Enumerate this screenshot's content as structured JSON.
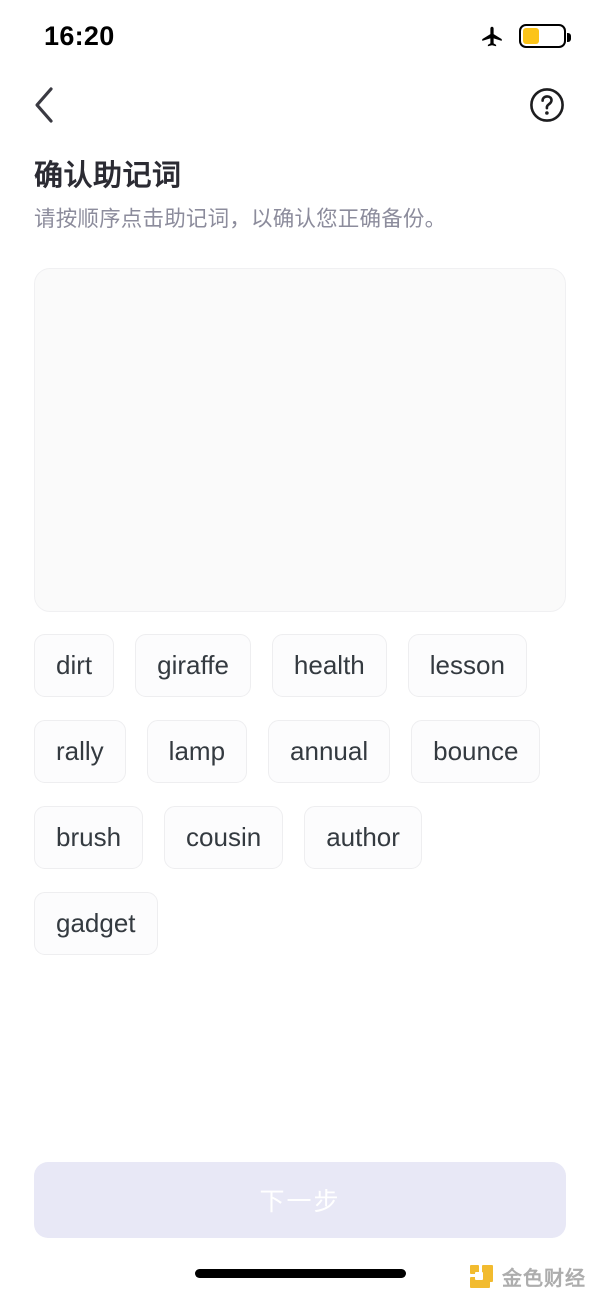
{
  "status_bar": {
    "time": "16:20",
    "airplane_icon": "airplane-mode-icon",
    "battery_icon": "battery-icon",
    "battery_level_percent": 40,
    "battery_fill_color": "#fcc419"
  },
  "nav": {
    "back_icon": "chevron-left-icon",
    "help_icon": "question-mark-circle-icon"
  },
  "header": {
    "title": "确认助记词",
    "subtitle": "请按顺序点击助记词，以确认您正确备份。"
  },
  "answer_area": {
    "selected_words": [],
    "background_color": "#fafafa"
  },
  "word_pool": {
    "words": [
      "dirt",
      "giraffe",
      "health",
      "lesson",
      "rally",
      "lamp",
      "annual",
      "bounce",
      "brush",
      "cousin",
      "author",
      "gadget"
    ]
  },
  "footer": {
    "next_label": "下一步",
    "next_enabled": false,
    "next_bg_color": "#e8e8f6",
    "next_text_color": "#ffffff"
  },
  "watermark": {
    "text": "金色财经",
    "logo_icon": "jinse-finance-logo-icon",
    "logo_color": "#f2b824"
  }
}
